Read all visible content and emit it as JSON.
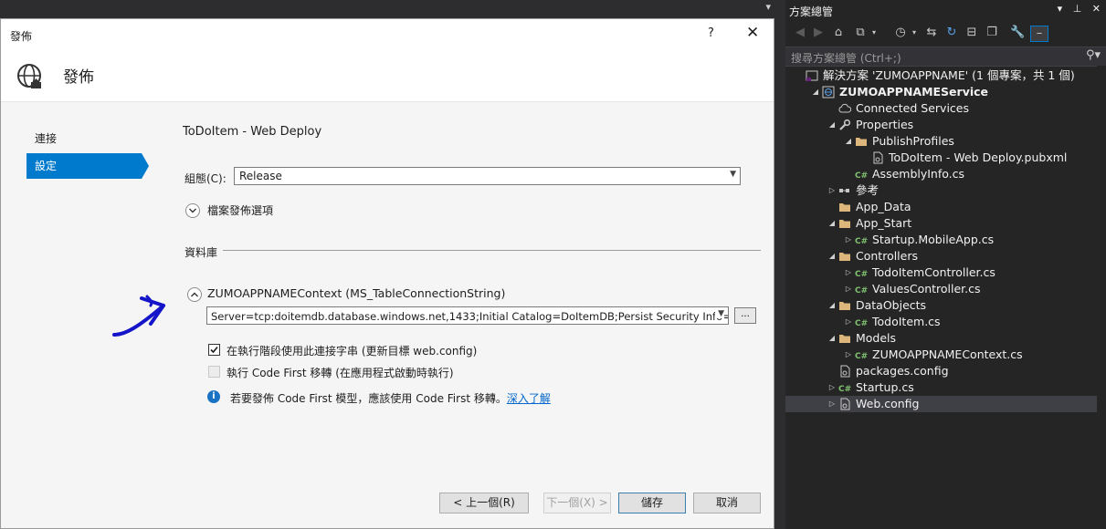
{
  "dialog": {
    "window_title": "發佈",
    "help_glyph": "?",
    "close_glyph": "✕",
    "header_title": "發佈",
    "nav": [
      {
        "label": "連接",
        "selected": false
      },
      {
        "label": "設定",
        "selected": true
      }
    ],
    "profile_title": "ToDoItem - Web Deploy",
    "configuration_label": "組態(C):",
    "configuration_value": "Release",
    "file_publish_options_label": "檔案發佈選項",
    "databases_label": "資料庫",
    "context_label": "ZUMOAPPNAMEContext (MS_TableConnectionString)",
    "connection_string": "Server=tcp:doitemdb.database.windows.net,1433;Initial Catalog=DoItemDB;Persist Security Info=False;User ID=",
    "ellipsis_label": "...",
    "use_runtime_conn_label": "在執行階段使用此連接字串 (更新目標 web.config)",
    "use_runtime_conn_checked": true,
    "code_first_label": "執行 Code First 移轉 (在應用程式啟動時執行)",
    "code_first_checked": false,
    "info_text": "若要發佈 Code First 模型，應該使用 Code First 移轉。",
    "info_link": "深入了解",
    "buttons": {
      "prev": "< 上一個(R)",
      "next": "下一個(X) >",
      "save": "儲存",
      "cancel": "取消"
    },
    "accent_color": "#007acc",
    "annotation_color": "#1414c8"
  },
  "solution_explorer": {
    "title": "方案總管",
    "title_buttons": [
      "▾",
      "⊥",
      "✕"
    ],
    "search_placeholder": "搜尋方案總管 (Ctrl+;)",
    "tree": [
      {
        "label": "解決方案 'ZUMOAPPNAME' (1 個專案，共 1 個)",
        "icon": "solution-icon",
        "indent": 0,
        "twist": "",
        "bold": false
      },
      {
        "label": "ZUMOAPPNAMEService",
        "icon": "web-project-icon",
        "indent": 1,
        "twist": "expanded",
        "bold": true
      },
      {
        "label": "Connected Services",
        "icon": "cloud-icon",
        "indent": 2,
        "twist": "",
        "bold": false
      },
      {
        "label": "Properties",
        "icon": "wrench-icon",
        "indent": 2,
        "twist": "expanded",
        "bold": false
      },
      {
        "label": "PublishProfiles",
        "icon": "folder-icon",
        "indent": 3,
        "twist": "expanded",
        "bold": false
      },
      {
        "label": "ToDoItem - Web Deploy.pubxml",
        "icon": "config-file-icon",
        "indent": 4,
        "twist": "",
        "bold": false
      },
      {
        "label": "AssemblyInfo.cs",
        "icon": "csharp-file-icon",
        "indent": 3,
        "twist": "",
        "bold": false
      },
      {
        "label": "參考",
        "icon": "references-icon",
        "indent": 2,
        "twist": "collapsed",
        "bold": false
      },
      {
        "label": "App_Data",
        "icon": "folder-icon",
        "indent": 2,
        "twist": "",
        "bold": false
      },
      {
        "label": "App_Start",
        "icon": "folder-icon",
        "indent": 2,
        "twist": "expanded",
        "bold": false
      },
      {
        "label": "Startup.MobileApp.cs",
        "icon": "csharp-file-icon",
        "indent": 3,
        "twist": "collapsed",
        "bold": false
      },
      {
        "label": "Controllers",
        "icon": "folder-icon",
        "indent": 2,
        "twist": "expanded",
        "bold": false
      },
      {
        "label": "TodoItemController.cs",
        "icon": "csharp-file-icon",
        "indent": 3,
        "twist": "collapsed",
        "bold": false
      },
      {
        "label": "ValuesController.cs",
        "icon": "csharp-file-icon",
        "indent": 3,
        "twist": "collapsed",
        "bold": false
      },
      {
        "label": "DataObjects",
        "icon": "folder-icon",
        "indent": 2,
        "twist": "expanded",
        "bold": false
      },
      {
        "label": "TodoItem.cs",
        "icon": "csharp-file-icon",
        "indent": 3,
        "twist": "collapsed",
        "bold": false
      },
      {
        "label": "Models",
        "icon": "folder-icon",
        "indent": 2,
        "twist": "expanded",
        "bold": false
      },
      {
        "label": "ZUMOAPPNAMEContext.cs",
        "icon": "csharp-file-icon",
        "indent": 3,
        "twist": "collapsed",
        "bold": false
      },
      {
        "label": "packages.config",
        "icon": "config-file-icon",
        "indent": 2,
        "twist": "",
        "bold": false
      },
      {
        "label": "Startup.cs",
        "icon": "csharp-file-icon",
        "indent": 2,
        "twist": "collapsed",
        "bold": false
      },
      {
        "label": "Web.config",
        "icon": "config-file-icon",
        "indent": 2,
        "twist": "collapsed",
        "bold": false,
        "selected": true
      }
    ]
  }
}
